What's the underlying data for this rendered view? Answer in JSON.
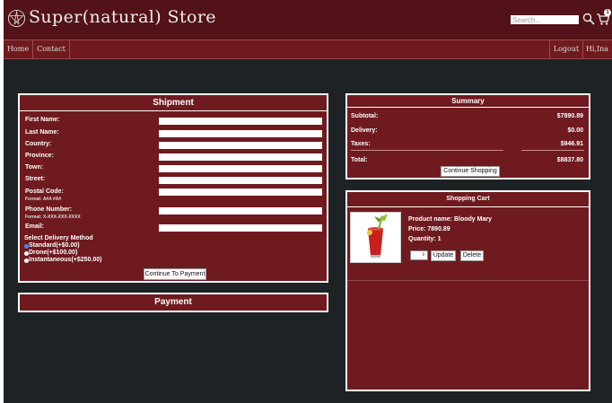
{
  "app": {
    "brand": "Super(natural) Store"
  },
  "header": {
    "search_placeholder": "Search...",
    "cart_count": "1"
  },
  "nav": {
    "home": "Home",
    "contact": "Contact",
    "logout": "Logout",
    "user": "Hi,Ina"
  },
  "shipment": {
    "title": "Shipment",
    "fields": [
      {
        "label": "First Name:",
        "value": ""
      },
      {
        "label": "Last Name:",
        "value": ""
      },
      {
        "label": "Country:",
        "value": ""
      },
      {
        "label": "Province:",
        "value": ""
      },
      {
        "label": "Town:",
        "value": ""
      },
      {
        "label": "Street:",
        "value": ""
      },
      {
        "label": "Postal Code:",
        "format": "Format: A#A #A#",
        "value": ""
      },
      {
        "label": "Phone Number:",
        "format": "Format: X-XXX-XXX-XXXX",
        "value": ""
      },
      {
        "label": "Email:",
        "value": ""
      }
    ],
    "delivery_title": "Select Delivery Method",
    "delivery_options": [
      {
        "label": "Standard(+$0.00)",
        "selected": true
      },
      {
        "label": "Drone(+$100.00)",
        "selected": false
      },
      {
        "label": "Instantaneous(+$250.00)",
        "selected": false
      }
    ],
    "continue_label": "Continue To Payment"
  },
  "payment": {
    "title": "Payment"
  },
  "summary": {
    "title": "Summary",
    "rows": [
      {
        "label": "Subtotal:",
        "value": "$7890.89"
      },
      {
        "label": "Delivery:",
        "value": "$0.00"
      },
      {
        "label": "Taxes:",
        "value": "$946.91"
      },
      {
        "label": "Total:",
        "value": "$8837.80"
      }
    ],
    "continue_label": "Continue Shopping"
  },
  "cart": {
    "title": "Shopping Cart",
    "item": {
      "name": "Product name: Bloody Mary",
      "price": "Price: 7890.89",
      "quantity": "Quantity: 1",
      "qty_value": "1",
      "update_label": "Update",
      "delete_label": "Delete"
    }
  },
  "colors": {
    "background": "#1d2225",
    "panel": "#6f1a1f",
    "header": "#521217"
  }
}
